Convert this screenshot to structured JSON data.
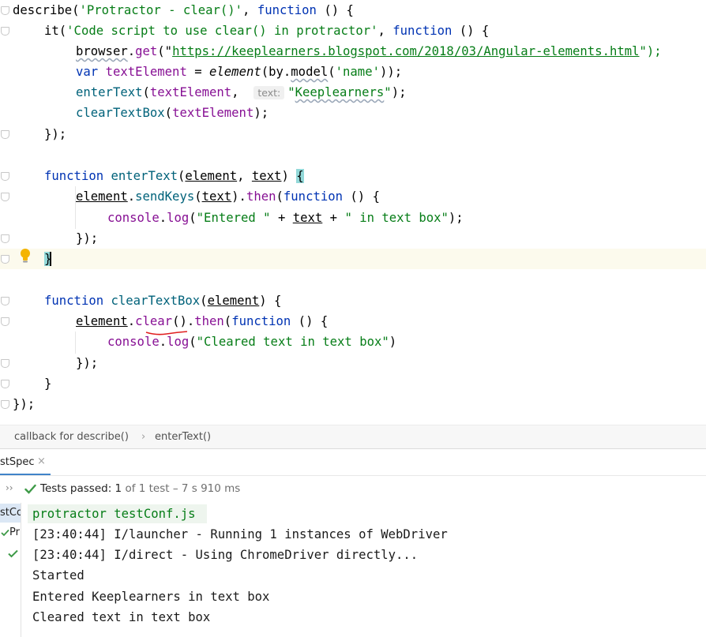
{
  "editor": {
    "lines": [
      [
        {
          "t": "describe("
        },
        {
          "t": "'Protractor - clear()'",
          "c": "str"
        },
        {
          "t": ", "
        },
        {
          "t": "function",
          "c": "kw"
        },
        {
          "t": " () {"
        }
      ],
      [
        {
          "t": "it("
        },
        {
          "t": "'Code script to use clear() in protractor'",
          "c": "str"
        },
        {
          "t": ", "
        },
        {
          "t": "function",
          "c": "kw"
        },
        {
          "t": " () {"
        }
      ],
      [
        {
          "t": "browser",
          "c": "wavy"
        },
        {
          "t": "."
        },
        {
          "t": "get",
          "c": "mem"
        },
        {
          "t": "(\""
        },
        {
          "t": "https://keeplearners.blogspot.com/2018/03/Angular-elements.html",
          "c": "lnk"
        },
        {
          "t": "\");",
          "c": "str"
        }
      ],
      [
        {
          "t": "var",
          "c": "kw"
        },
        {
          "t": " "
        },
        {
          "t": "textElement",
          "c": "mem"
        },
        {
          "t": " = "
        },
        {
          "t": "element",
          "c": "it"
        },
        {
          "t": "(by."
        },
        {
          "t": "model",
          "c": "wavy"
        },
        {
          "t": "("
        },
        {
          "t": "'name'",
          "c": "str"
        },
        {
          "t": "));"
        }
      ],
      [
        {
          "t": "enterText",
          "c": "fn"
        },
        {
          "t": "("
        },
        {
          "t": "textElement",
          "c": "mem"
        },
        {
          "t": ",  "
        },
        {
          "t": "text:",
          "c": "hint"
        },
        {
          "t": "\"",
          "c": "str"
        },
        {
          "t": "Keeplearners",
          "c": "str wavy"
        },
        {
          "t": "\"",
          "c": "str"
        },
        {
          "t": ");"
        }
      ],
      [
        {
          "t": "clearTextBox",
          "c": "fn"
        },
        {
          "t": "("
        },
        {
          "t": "textElement",
          "c": "mem"
        },
        {
          "t": ");"
        }
      ],
      [
        {
          "t": "});"
        }
      ],
      [],
      [
        {
          "t": "function",
          "c": "kw"
        },
        {
          "t": " "
        },
        {
          "t": "enterText",
          "c": "fn"
        },
        {
          "t": "("
        },
        {
          "t": "element",
          "c": "par"
        },
        {
          "t": ", "
        },
        {
          "t": "text",
          "c": "par"
        },
        {
          "t": ") "
        },
        {
          "t": "{",
          "c": "brace-match"
        }
      ],
      [
        {
          "t": "element",
          "c": "par"
        },
        {
          "t": "."
        },
        {
          "t": "sendKeys",
          "c": "fn"
        },
        {
          "t": "("
        },
        {
          "t": "text",
          "c": "par"
        },
        {
          "t": ")."
        },
        {
          "t": "then",
          "c": "mem"
        },
        {
          "t": "("
        },
        {
          "t": "function",
          "c": "kw"
        },
        {
          "t": " () {"
        }
      ],
      [
        {
          "t": "console",
          "c": "mem"
        },
        {
          "t": "."
        },
        {
          "t": "log",
          "c": "mem"
        },
        {
          "t": "("
        },
        {
          "t": "\"Entered \"",
          "c": "str"
        },
        {
          "t": " + "
        },
        {
          "t": "text",
          "c": "par"
        },
        {
          "t": " + "
        },
        {
          "t": "\" in text box\"",
          "c": "str"
        },
        {
          "t": ");"
        }
      ],
      [
        {
          "t": "});"
        }
      ],
      [
        {
          "t": "}",
          "c": "brace-match"
        }
      ],
      [],
      [
        {
          "t": "function",
          "c": "kw"
        },
        {
          "t": " "
        },
        {
          "t": "clearTextBox",
          "c": "fn"
        },
        {
          "t": "("
        },
        {
          "t": "element",
          "c": "par"
        },
        {
          "t": ") {"
        }
      ],
      [
        {
          "t": "element",
          "c": "par"
        },
        {
          "t": "."
        },
        {
          "t": "clear",
          "c": "mem"
        },
        {
          "t": "()."
        },
        {
          "t": "then",
          "c": "mem"
        },
        {
          "t": "("
        },
        {
          "t": "function",
          "c": "kw"
        },
        {
          "t": " () {"
        }
      ],
      [
        {
          "t": "console",
          "c": "mem"
        },
        {
          "t": "."
        },
        {
          "t": "log",
          "c": "mem"
        },
        {
          "t": "("
        },
        {
          "t": "\"Cleared text in text box\"",
          "c": "str"
        },
        {
          "t": ")"
        }
      ],
      [
        {
          "t": "});"
        }
      ],
      [
        {
          "t": "}"
        }
      ],
      [
        {
          "t": "});"
        }
      ]
    ]
  },
  "breadcrumb": {
    "items": [
      "callback for describe()",
      "enterText()"
    ],
    "separator": "›"
  },
  "run": {
    "tab_label": "stSpec",
    "close_glyph": "×",
    "expand_glyph": "››",
    "status_label": "Tests passed:",
    "status_count": "1",
    "status_rest": "of 1 test – 7 s 910 ms",
    "tree_items": [
      "stCo",
      "Pr"
    ]
  },
  "console": {
    "lines": [
      "protractor testConf.js",
      "[23:40:44] I/launcher - Running 1 instances of WebDriver",
      "[23:40:44] I/direct - Using ChromeDriver directly...",
      "Started",
      "Entered Keeplearners in text box",
      "Cleared text in text box"
    ]
  }
}
